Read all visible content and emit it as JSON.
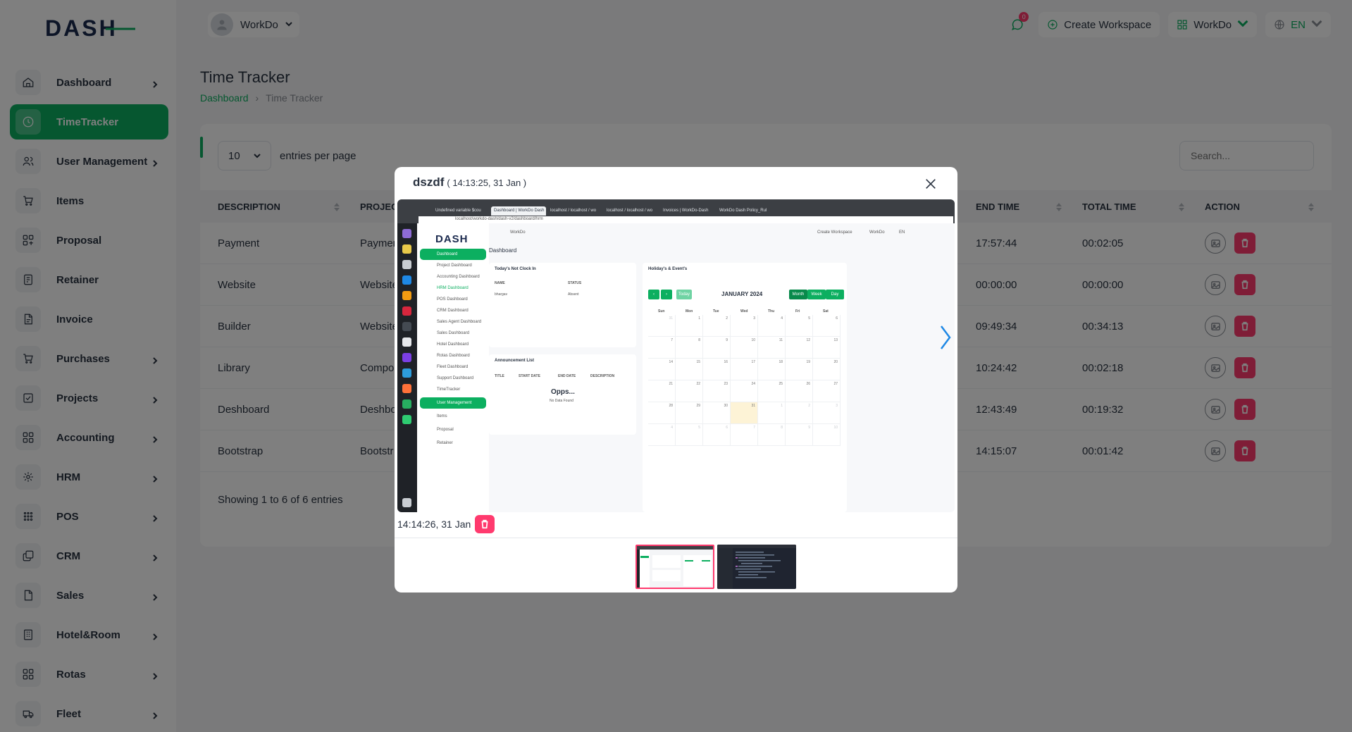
{
  "brand": {
    "logo_text": "DASH",
    "accent": "#0caf60",
    "danger": "#ff3a6e"
  },
  "sidebar": {
    "items": [
      {
        "label": "Dashboard",
        "icon": "home-icon",
        "has_children": true
      },
      {
        "label": "TimeTracker",
        "icon": "clock-icon",
        "has_children": false,
        "active": true
      },
      {
        "label": "User Management",
        "icon": "users-icon",
        "has_children": true
      },
      {
        "label": "Items",
        "icon": "cart-icon",
        "has_children": false
      },
      {
        "label": "Proposal",
        "icon": "proposal-icon",
        "has_children": false
      },
      {
        "label": "Retainer",
        "icon": "retainer-icon",
        "has_children": false
      },
      {
        "label": "Invoice",
        "icon": "invoice-icon",
        "has_children": false
      },
      {
        "label": "Purchases",
        "icon": "cart-icon",
        "has_children": true
      },
      {
        "label": "Projects",
        "icon": "check-square-icon",
        "has_children": true
      },
      {
        "label": "Accounting",
        "icon": "grid-icon",
        "has_children": true
      },
      {
        "label": "HRM",
        "icon": "hrm-icon",
        "has_children": true
      },
      {
        "label": "POS",
        "icon": "dots-grid-icon",
        "has_children": true
      },
      {
        "label": "CRM",
        "icon": "layers-icon",
        "has_children": true
      },
      {
        "label": "Sales",
        "icon": "file-icon",
        "has_children": true
      },
      {
        "label": "Hotel&Room",
        "icon": "building-icon",
        "has_children": true
      },
      {
        "label": "Rotas",
        "icon": "grid-icon",
        "has_children": true
      },
      {
        "label": "Fleet",
        "icon": "truck-icon",
        "has_children": true
      }
    ]
  },
  "header": {
    "user_name": "WorkDo",
    "message_count": "0",
    "create_workspace": "Create Workspace",
    "workspace": "WorkDo",
    "language": "EN"
  },
  "page": {
    "title": "Time Tracker",
    "breadcrumb": {
      "home": "Dashboard",
      "current": "Time Tracker"
    }
  },
  "table": {
    "per_page_value": "10",
    "per_page_label": "entries per page",
    "search_placeholder": "Search...",
    "columns": {
      "description": "DESCRIPTION",
      "project": "PROJECT",
      "end_time": "END TIME",
      "total_time": "TOTAL TIME",
      "action": "ACTION"
    },
    "rows": [
      {
        "description": "Payment",
        "project": "Payment",
        "end_time": "17:57:44",
        "total_time": "00:02:05"
      },
      {
        "description": "Website",
        "project": "Website",
        "end_time": "00:00:00",
        "total_time": "00:00:00"
      },
      {
        "description": "Builder",
        "project": "Website",
        "end_time": "09:49:34",
        "total_time": "00:34:13"
      },
      {
        "description": "Library",
        "project": "Compo",
        "end_time": "10:24:42",
        "total_time": "00:02:18"
      },
      {
        "description": "Deshboard",
        "project": "Deshbo",
        "end_time": "12:43:49",
        "total_time": "00:19:32"
      },
      {
        "description": "Bootstrap",
        "project": "Bootstr",
        "end_time": "14:15:07",
        "total_time": "00:01:42"
      }
    ],
    "showing": "Showing 1 to 6 of 6 entries"
  },
  "modal": {
    "title": "dszdf",
    "subtitle": "( 14:13:25, 31 Jan )",
    "caption": "14:14:26, 31 Jan",
    "screenshot": {
      "tabs": [
        "Undefined variable $cou",
        "Dashboard | WorkDo Dash",
        "localhost / localhost / wo",
        "localhost / localhost / wo",
        "Invoices | WorkDo-Dash",
        "WorkDo Dash Policy_Rul"
      ],
      "url": "localhost/workdo-dash/dash-v2/dashboard/hrm",
      "logo": "DASH",
      "side_items": [
        "Dashboard",
        "Project Dashboard",
        "Accounting Dashboard",
        "HRM Dashboard",
        "POS Dashboard",
        "CRM Dashboard",
        "Sales Agent Dashboard",
        "Sales Dashboard",
        "Hotel Dashboard",
        "Rotas Dashboard",
        "Fleet Dashboard",
        "Support Dashboard",
        "TimeTracker",
        "User Management",
        "Items",
        "Proposal",
        "Retainer"
      ],
      "header_user": "WorkDo",
      "header_create": "Create Workspace",
      "header_ws": "WorkDo",
      "header_lang": "EN",
      "page_title": "Dashboard",
      "card1_title": "Today's Not Clock In",
      "card1_col_name": "NAME",
      "card1_col_status": "STATUS",
      "card1_row_name": "bhargav",
      "card1_row_status": "Absent",
      "card2_title": "Announcement List",
      "card2_cols": [
        "TITLE",
        "START DATE",
        "END DATE",
        "DESCRIPTION"
      ],
      "card2_empty_title": "Opps...",
      "card2_empty_sub": "No Data Found",
      "cal_title": "Holiday's & Event's",
      "cal_today": "Today",
      "cal_month": "JANUARY 2024",
      "cal_views": [
        "Month",
        "Week",
        "Day"
      ],
      "cal_days": [
        "Sun",
        "Mon",
        "Tue",
        "Wed",
        "Thu",
        "Fri",
        "Sat"
      ],
      "cal_dates": [
        "31",
        "1",
        "2",
        "3",
        "4",
        "5",
        "6",
        "7",
        "8",
        "9",
        "10",
        "11",
        "12",
        "13",
        "14",
        "15",
        "16",
        "17",
        "18",
        "19",
        "20",
        "21",
        "22",
        "23",
        "24",
        "25",
        "26",
        "27",
        "28",
        "29",
        "30",
        "31",
        "1",
        "2",
        "3",
        "4",
        "5",
        "6",
        "7",
        "8",
        "9",
        "10"
      ]
    }
  }
}
